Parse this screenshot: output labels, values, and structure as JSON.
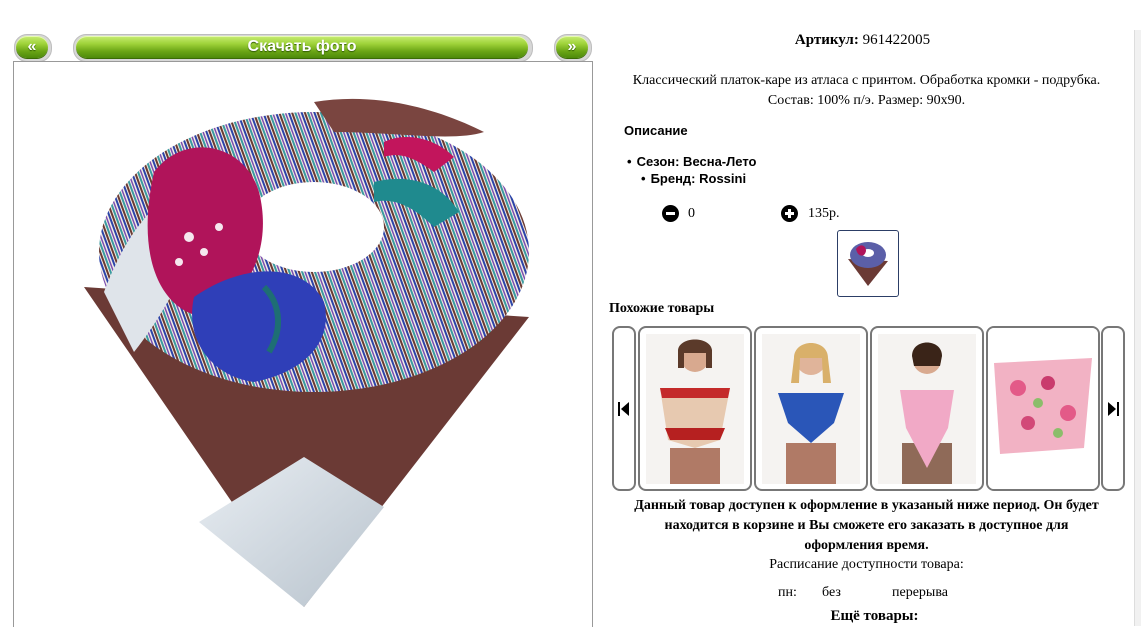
{
  "toolbar": {
    "prev_label": "«",
    "download_label": "Скачать фото",
    "next_label": "»"
  },
  "product": {
    "article_label": "Артикул:",
    "article_value": "961422005",
    "description_line1": "Классический платок-каре из атласа с принтом. Обработка кромки - подрубка.",
    "description_line2": "Состав: 100% п/э. Размер: 90x90.",
    "section_title": "Описание",
    "props": [
      "Сезон: Весна-Лето",
      "Бренд: Rossini"
    ],
    "quantity": "0",
    "price": "135р."
  },
  "similar": {
    "title": "Похожие товары"
  },
  "availability": {
    "notice_line1": "Данный товар доступен к оформление в указаный ниже период. Он будет",
    "notice_line2": "находится в корзине и Вы сможете его заказать в доступное для",
    "notice_line3": "оформления время.",
    "schedule_title": "Расписание доступности товара:",
    "day": "пн:",
    "from": "без",
    "to": "перерыва"
  },
  "more": {
    "title": "Ещё товары:"
  },
  "colors": {
    "green_button": "#7bbf1e",
    "scarf_brown": "#6b3a35",
    "scarf_magenta": "#b0145a",
    "scarf_blue": "#2f3fb8"
  }
}
